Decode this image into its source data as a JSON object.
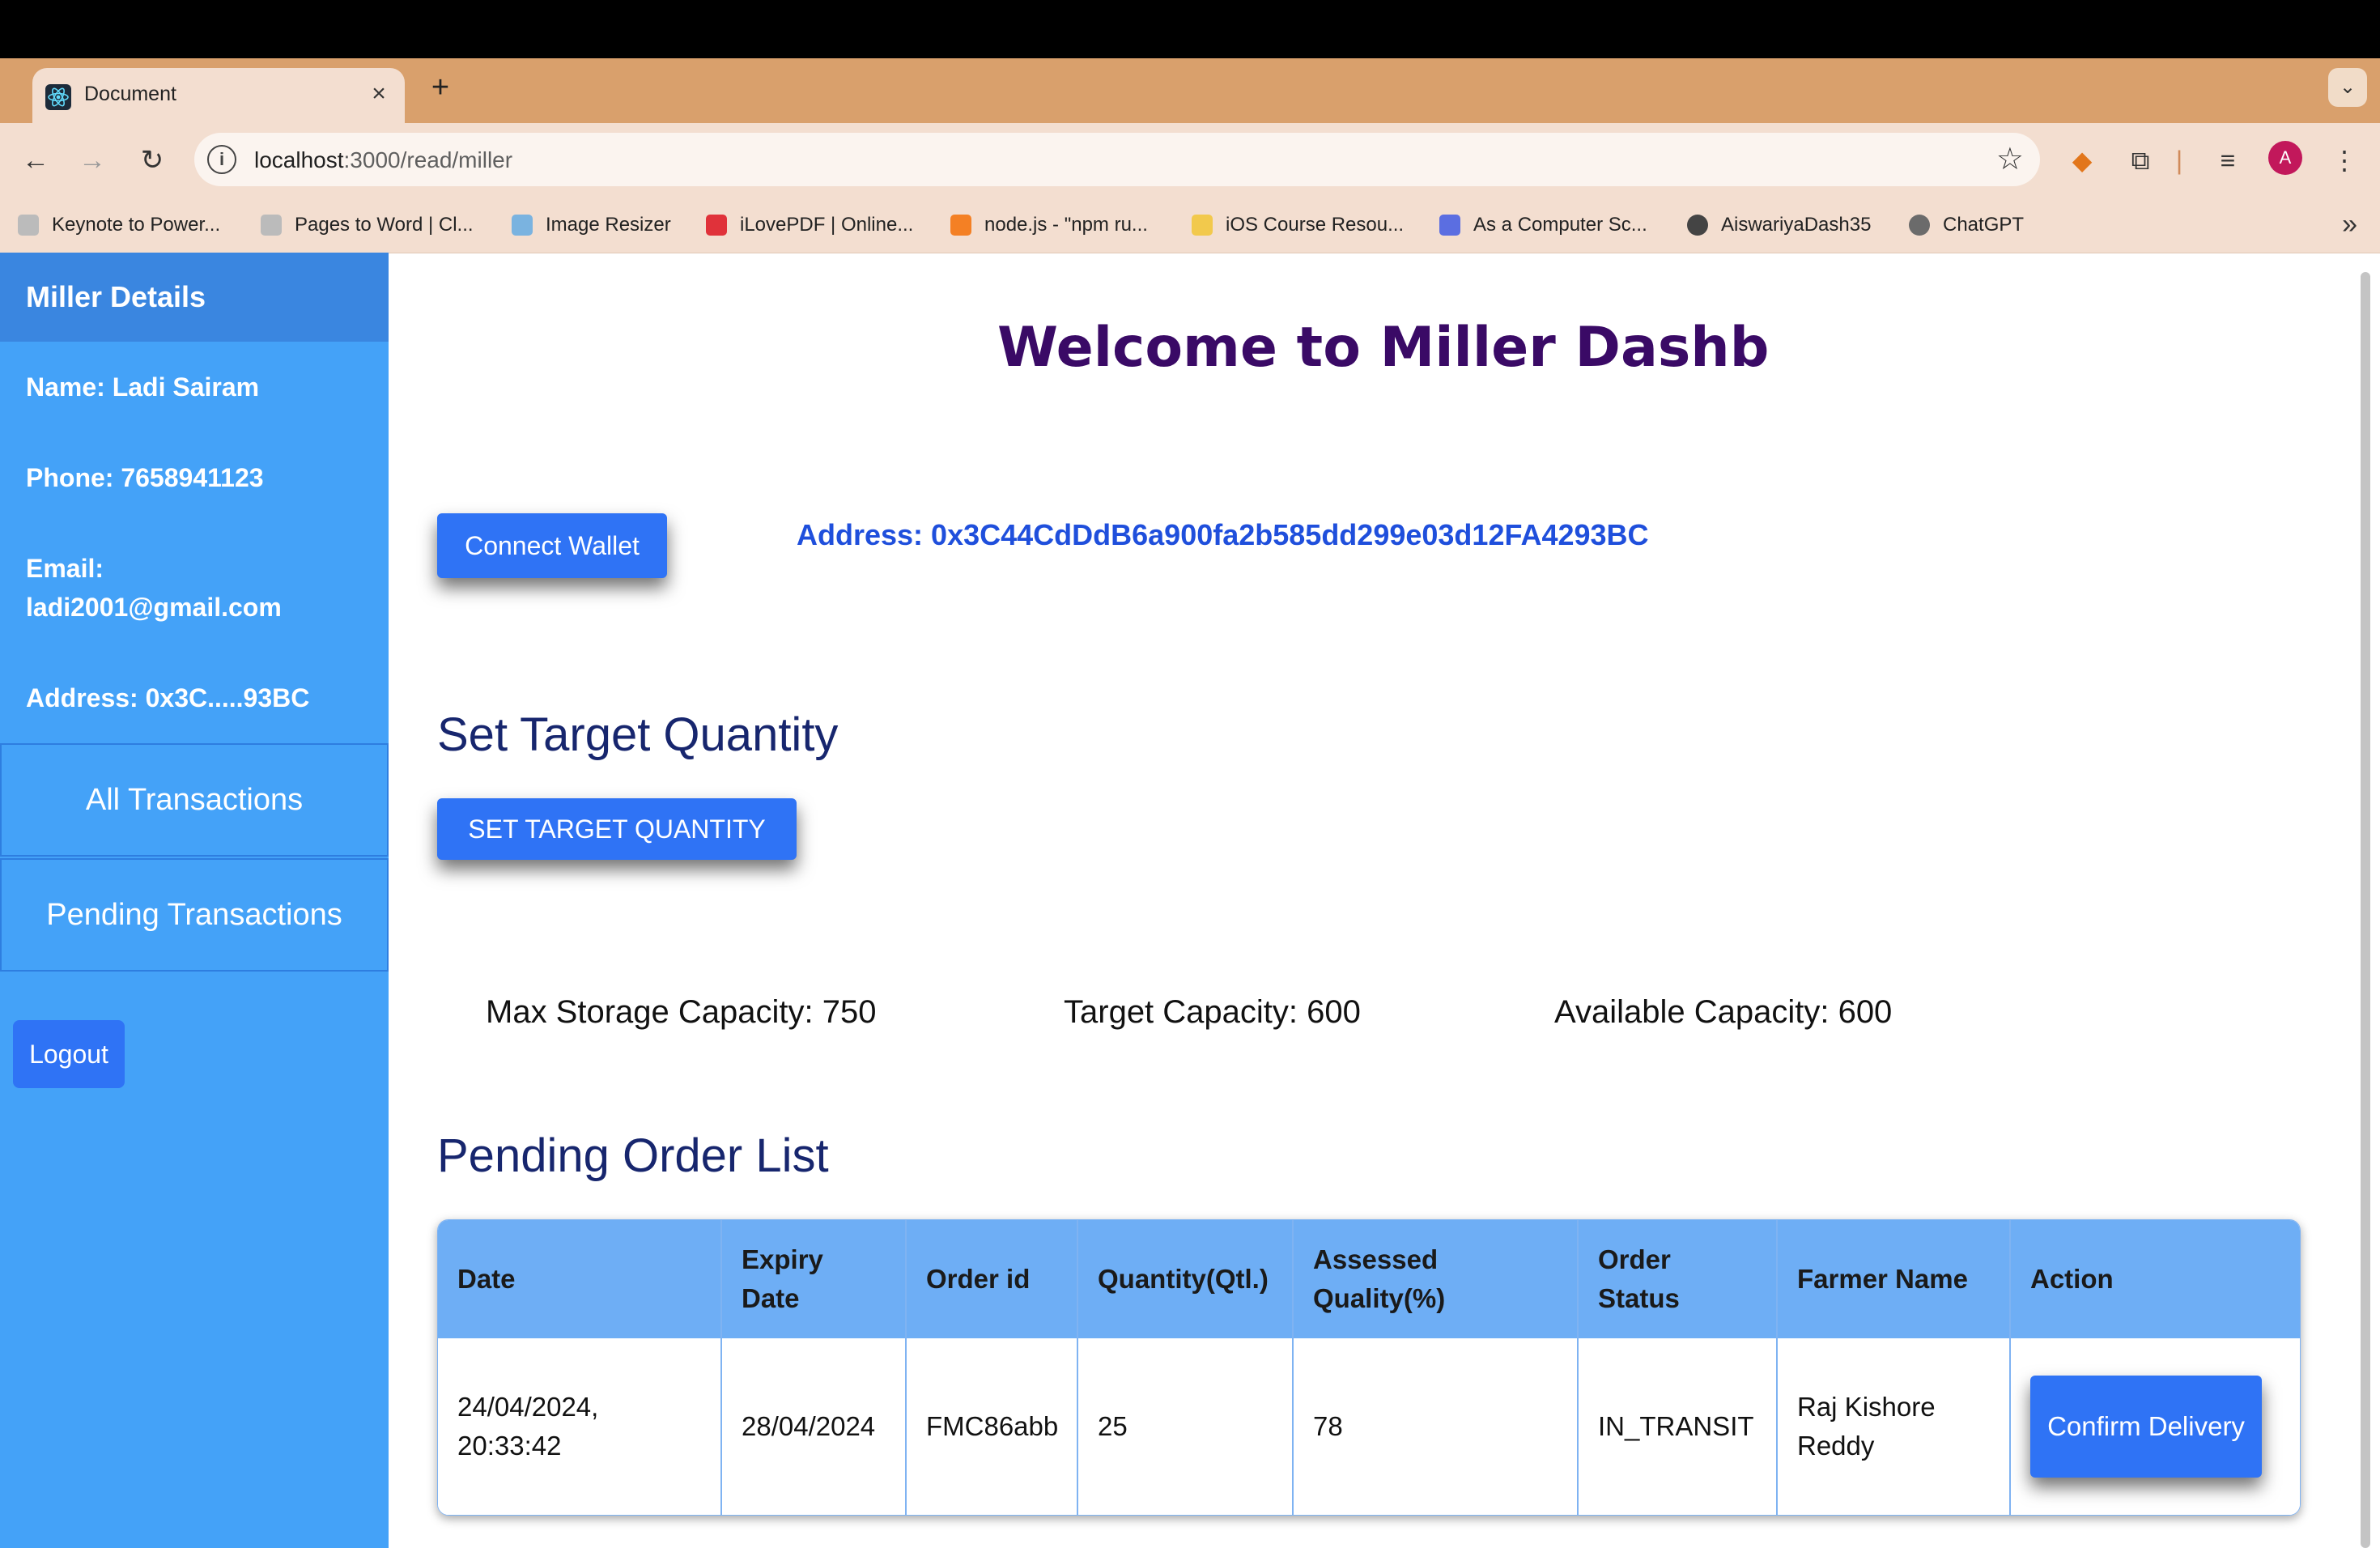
{
  "browser": {
    "tab_title": "Document",
    "tab_close": "×",
    "new_tab": "+",
    "url_host": "localhost",
    "url_path": ":3000/read/miller",
    "avatar_letter": "A",
    "bookmarks": [
      {
        "label": "Keynote to Power...",
        "color": "#888888"
      },
      {
        "label": "Pages to Word | Cl...",
        "color": "#888888"
      },
      {
        "label": "Image Resizer",
        "color": "#7ab3e0"
      },
      {
        "label": "iLovePDF | Online...",
        "color": "#e0323a"
      },
      {
        "label": "node.js - \"npm ru...",
        "color": "#f48024"
      },
      {
        "label": "iOS Course Resou...",
        "color": "#f2c94c"
      },
      {
        "label": "As a Computer Sc...",
        "color": "#5b6ee1"
      },
      {
        "label": "AiswariyaDash35",
        "color": "#444444"
      },
      {
        "label": "ChatGPT",
        "color": "#6b6b6b"
      }
    ]
  },
  "sidebar": {
    "title": "Miller Details",
    "name": "Name: Ladi Sairam",
    "phone": "Phone: 7658941123",
    "email_label": "Email:",
    "email_value": "ladi2001@gmail.com",
    "address": "Address: 0x3C.....93BC",
    "nav": [
      "All Transactions",
      "Pending Transactions"
    ],
    "logout": "Logout"
  },
  "main": {
    "welcome": "Welcome to Miller Dashb",
    "connect_button": "Connect Wallet",
    "address": "Address: 0x3C44CdDdB6a900fa2b585dd299e03d12FA4293BC",
    "target_heading": "Set Target Quantity",
    "target_button": "SET TARGET QUANTITY",
    "capacities": {
      "max": "Max Storage Capacity: 750",
      "target": "Target Capacity: 600",
      "available": "Available Capacity: 600"
    },
    "orders_heading": "Pending Order List",
    "table": {
      "headers": [
        "Date",
        "Expiry Date",
        "Order id",
        "Quantity(Qtl.)",
        "Assessed Quality(%)",
        "Order Status",
        "Farmer Name",
        "Action"
      ],
      "rows": [
        {
          "date": "24/04/2024, 20:33:42",
          "expiry": "28/04/2024",
          "order_id": "FMC86abb",
          "quantity": "25",
          "quality": "78",
          "status": "IN_TRANSIT",
          "farmer": "Raj Kishore Reddy",
          "action": "Confirm Delivery"
        }
      ]
    }
  },
  "colors": {
    "sidebar": "#44a2f8",
    "sidebar_header": "#3a86e0",
    "button": "#2f73f5",
    "welcome": "#3a0a66",
    "address": "#1f4fdc",
    "table_header": "#6eaef5"
  }
}
